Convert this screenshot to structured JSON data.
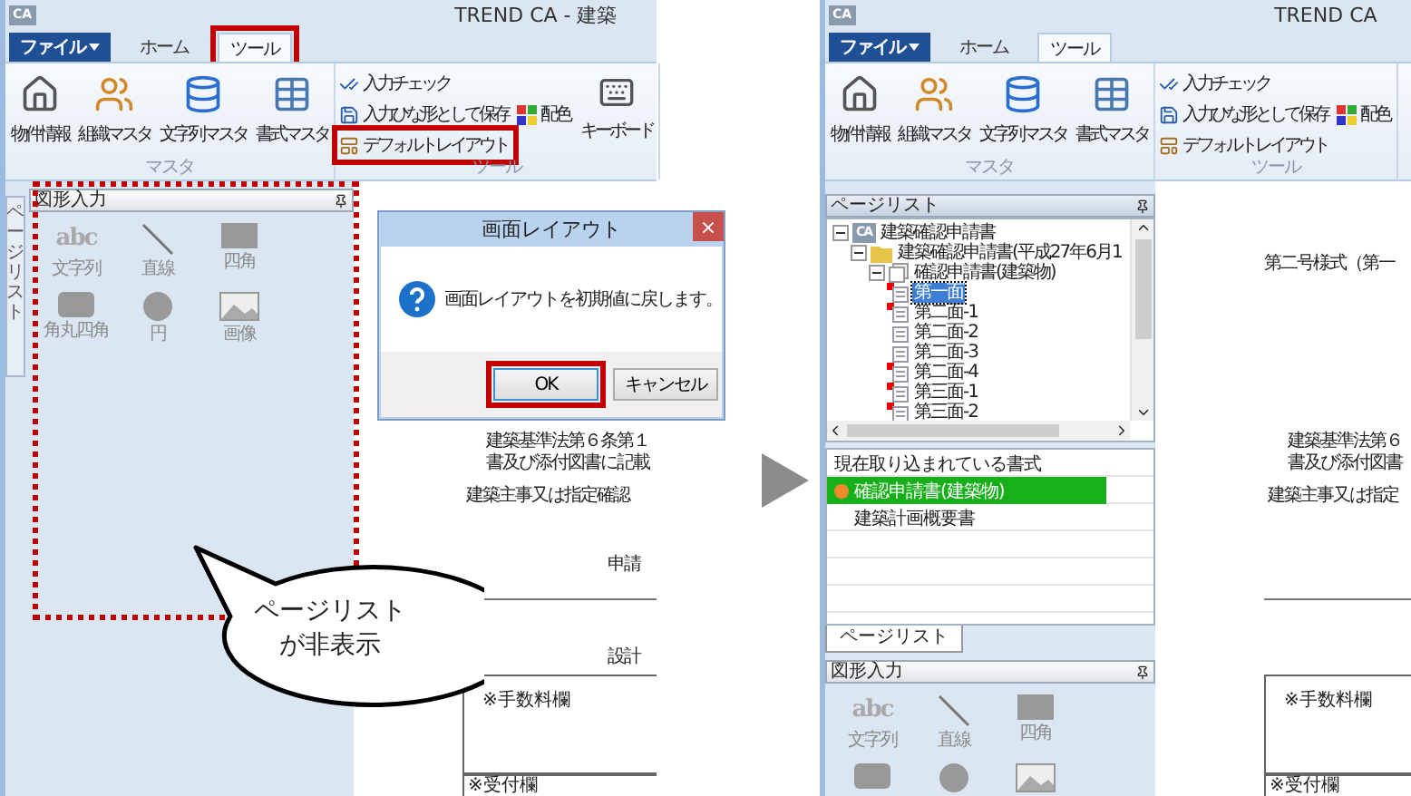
{
  "screens": [
    {
      "title": "TREND CA - 建築",
      "badge": "CA",
      "tabs": [
        {
          "label": "ファイル",
          "kind": "menu",
          "selected": false,
          "highlighted": false
        },
        {
          "label": "ホーム",
          "kind": "tab",
          "selected": false,
          "highlighted": false
        },
        {
          "label": "ツール",
          "kind": "tab",
          "selected": true,
          "highlighted": true
        }
      ],
      "ribbon": {
        "master_buttons": [
          "物件情報",
          "組織マスタ",
          "文字列マスタ",
          "書式マスタ"
        ],
        "master_group": "マスタ",
        "tool_buttons": [
          {
            "label": "入力チェック",
            "highlighted": false
          },
          {
            "label": "入力ひな形として保存",
            "highlighted": false
          },
          {
            "label": "デフォルトレイアウト",
            "highlighted": true
          }
        ],
        "color_button": "配色",
        "keyboard_button": "キーボード",
        "tool_group": "ツール"
      },
      "side_tab": "ページリスト",
      "shape_panel": {
        "title": "図形入力",
        "highlighted": true,
        "tools": [
          {
            "kind": "text",
            "glyph": "abc",
            "label": "文字列"
          },
          {
            "kind": "line",
            "label": "直線"
          },
          {
            "kind": "rect",
            "label": "四角"
          },
          {
            "kind": "rounded",
            "label": "角丸四角"
          },
          {
            "kind": "circle",
            "label": "円"
          },
          {
            "kind": "image",
            "label": "画像"
          }
        ]
      },
      "document": {
        "lines": [
          {
            "kind": "body",
            "text": "建築基準法第６条第１"
          },
          {
            "kind": "body",
            "text": "書及び添付図書に記載"
          },
          {
            "kind": "body2",
            "text": "建築主事又は指定確認"
          },
          {
            "kind": "label",
            "text": "申請"
          },
          {
            "kind": "rule"
          },
          {
            "kind": "label",
            "text": "設計"
          },
          {
            "kind": "box",
            "text": "※手数料欄"
          },
          {
            "kind": "footer",
            "text": "※受付欄"
          }
        ]
      },
      "dialog": {
        "title": "画面レイアウト",
        "close": "×",
        "message": "画面レイアウトを初期値に戻します。",
        "buttons": [
          {
            "label": "OK",
            "default": true,
            "highlighted": true
          },
          {
            "label": "キャンセル",
            "default": false,
            "highlighted": false
          }
        ]
      }
    },
    {
      "title": "TREND CA",
      "badge": "CA",
      "tabs": [
        {
          "label": "ファイル",
          "kind": "menu",
          "selected": false,
          "highlighted": false
        },
        {
          "label": "ホーム",
          "kind": "tab",
          "selected": false,
          "highlighted": false
        },
        {
          "label": "ツール",
          "kind": "tab",
          "selected": true,
          "highlighted": false
        }
      ],
      "ribbon": {
        "master_buttons": [
          "物件情報",
          "組織マスタ",
          "文字列マスタ",
          "書式マスタ"
        ],
        "master_group": "マスタ",
        "tool_buttons": [
          {
            "label": "入力チェック",
            "highlighted": false
          },
          {
            "label": "入力ひな形として保存",
            "highlighted": false
          },
          {
            "label": "デフォルトレイアウト",
            "highlighted": false
          }
        ],
        "color_button": "配色",
        "tool_group": "ツール"
      },
      "page_list": {
        "title": "ページリスト",
        "tree": [
          {
            "label": "建築確認申請書",
            "badge": "CA",
            "expanded": true,
            "selected": false,
            "children": [
              {
                "label": "建築確認申請書(平成27年6月1",
                "expanded": true,
                "selected": false,
                "children": [
                  {
                    "label": "確認申請書(建築物)",
                    "expanded": true,
                    "selected": false,
                    "children": [
                      {
                        "label": "第一面",
                        "selected": true,
                        "marked": true
                      },
                      {
                        "label": "第二面-1",
                        "selected": false,
                        "marked": true
                      },
                      {
                        "label": "第二面-2",
                        "selected": false,
                        "marked": false
                      },
                      {
                        "label": "第二面-3",
                        "selected": false,
                        "marked": false
                      },
                      {
                        "label": "第二面-4",
                        "selected": false,
                        "marked": true
                      },
                      {
                        "label": "第三面-1",
                        "selected": false,
                        "marked": true
                      },
                      {
                        "label": "第三面-2",
                        "selected": false,
                        "marked": true
                      }
                    ]
                  }
                ]
              }
            ]
          }
        ],
        "formats": {
          "title": "現在取り込まれている書式",
          "items": [
            {
              "label": "確認申請書(建築物)",
              "selected": true
            },
            {
              "label": "建築計画概要書",
              "selected": false
            }
          ]
        },
        "tab": "ページリスト"
      },
      "shape_panel": {
        "title": "図形入力",
        "highlighted": false,
        "tools": [
          {
            "kind": "text",
            "glyph": "abc",
            "label": "文字列"
          },
          {
            "kind": "line",
            "label": "直線"
          },
          {
            "kind": "rect",
            "label": "四角"
          },
          {
            "kind": "rounded"
          },
          {
            "kind": "circle"
          },
          {
            "kind": "image"
          }
        ]
      },
      "document": {
        "lines": [
          {
            "kind": "title",
            "text": "第二号様式（第一"
          },
          {
            "kind": "body",
            "text": "建築基準法第６"
          },
          {
            "kind": "body",
            "text": "書及び添付図書"
          },
          {
            "kind": "body2",
            "text": "建築主事又は指定"
          },
          {
            "kind": "rule"
          },
          {
            "kind": "box",
            "text": "※手数料欄"
          },
          {
            "kind": "footer",
            "text": "※受付欄"
          }
        ]
      }
    }
  ],
  "callout": {
    "lines": [
      "ページリスト",
      "が非表示"
    ]
  }
}
